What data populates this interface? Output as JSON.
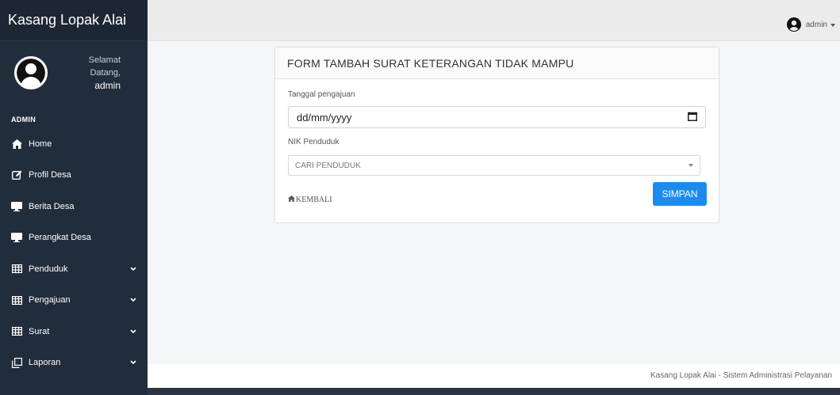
{
  "brand": {
    "title": "Kasang Lopak Alai"
  },
  "user_panel": {
    "greeting": "Selamat Datang,",
    "username": "admin"
  },
  "sidebar": {
    "section": "ADMIN",
    "items": [
      {
        "label": "Home",
        "icon": "home-icon",
        "has_submenu": false
      },
      {
        "label": "Profil Desa",
        "icon": "edit-icon",
        "has_submenu": false
      },
      {
        "label": "Berita Desa",
        "icon": "desktop-icon",
        "has_submenu": false
      },
      {
        "label": "Perangkat Desa",
        "icon": "desktop-icon",
        "has_submenu": false
      },
      {
        "label": "Penduduk",
        "icon": "table-icon",
        "has_submenu": true
      },
      {
        "label": "Pengajuan",
        "icon": "table-icon",
        "has_submenu": true
      },
      {
        "label": "Surat",
        "icon": "table-icon",
        "has_submenu": true
      },
      {
        "label": "Laporan",
        "icon": "copy-icon",
        "has_submenu": true
      }
    ]
  },
  "topbar": {
    "user_label": "admin"
  },
  "form": {
    "title": "FORM TAMBAH SURAT KETERANGAN TIDAK MAMPU",
    "date_label": "Tanggal pengajuan",
    "date_placeholder": "dd/mm/yyyy",
    "nik_label": "NIK Penduduk",
    "nik_placeholder": "CARI PENDUDUK",
    "back_label": "KEMBALI",
    "save_label": "SIMPAN"
  },
  "footer": {
    "text": "Kasang Lopak Alai - Sistem Administrasi Pelayanan"
  },
  "colors": {
    "sidebar_bg": "#222d3c",
    "primary": "#1a8cf0"
  }
}
